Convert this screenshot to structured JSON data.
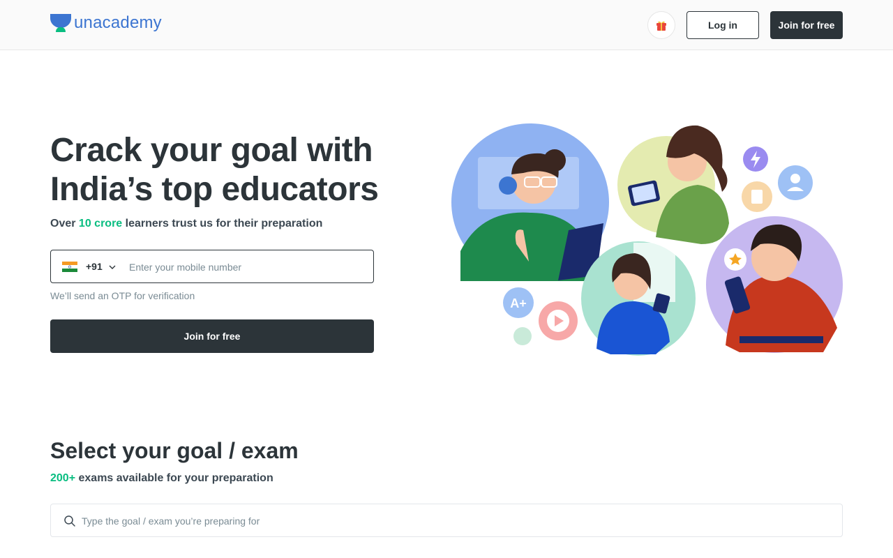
{
  "header": {
    "logo_text": "unacademy",
    "gift_icon": "gift-icon",
    "login_label": "Log in",
    "join_label": "Join for free"
  },
  "hero": {
    "title_line1": "Crack your goal with",
    "title_line2": "India’s top educators",
    "subtitle_prefix": "Over ",
    "subtitle_highlight": "10 crore",
    "subtitle_suffix": " learners trust us for their preparation",
    "country_code": "+91",
    "phone_placeholder": "Enter your mobile number",
    "otp_note": "We’ll send an OTP for verification",
    "join_label": "Join for free"
  },
  "goal": {
    "title": "Select your goal / exam",
    "subtitle_highlight": "200+",
    "subtitle_suffix": " exams available for your preparation",
    "search_placeholder": "Type the goal / exam you’re preparing for"
  },
  "colors": {
    "brand_blue": "#3c75d1",
    "accent_green": "#08bd80",
    "dark": "#2c3439"
  }
}
